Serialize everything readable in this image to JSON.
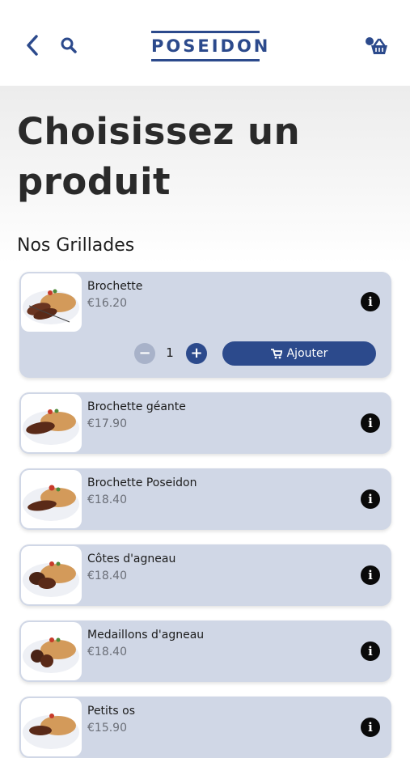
{
  "header": {
    "logo_text": "POSEIDON",
    "brand_color": "#2c4a8c",
    "icons": [
      "chevron-left-icon",
      "search-icon",
      "cart-icon"
    ]
  },
  "page": {
    "title": "Choisissez un produit",
    "section": "Nos Grillades"
  },
  "products": [
    {
      "name": "Brochette",
      "price": "€16.20",
      "quantity": "1",
      "add_label": "Ajouter"
    },
    {
      "name": "Brochette géante",
      "price": "€17.90"
    },
    {
      "name": "Brochette Poseidon",
      "price": "€18.40"
    },
    {
      "name": "Côtes d'agneau",
      "price": "€18.40"
    },
    {
      "name": "Medaillons d'agneau",
      "price": "€18.40"
    },
    {
      "name": "Petits os",
      "price": "€15.90"
    }
  ],
  "colors": {
    "card_bg": "#d0d7e6",
    "accent": "#2c4a8c",
    "minus_disabled": "#a8b2c9"
  }
}
